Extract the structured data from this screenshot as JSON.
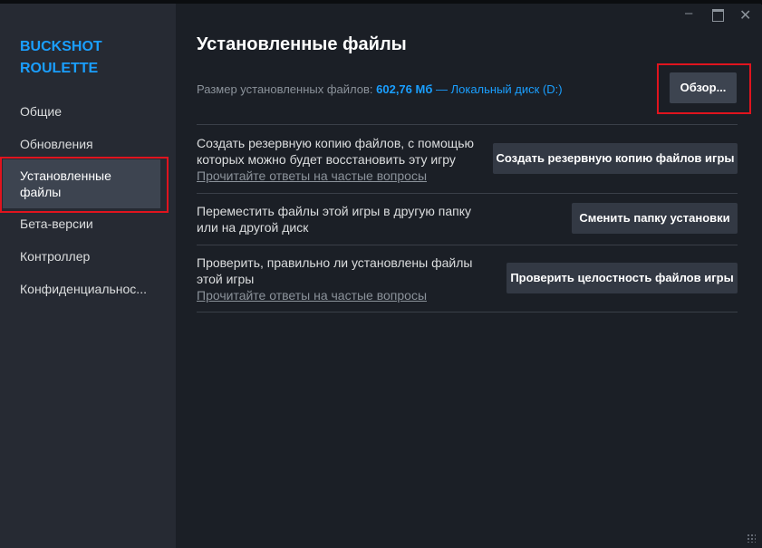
{
  "sidebar": {
    "app_title": "BUCKSHOT ROULETTE",
    "items": [
      {
        "label": "Общие"
      },
      {
        "label": "Обновления"
      },
      {
        "label": "Установленные файлы",
        "active": true
      },
      {
        "label": "Бета-версии"
      },
      {
        "label": "Контроллер"
      },
      {
        "label": "Конфиденциальнос..."
      }
    ]
  },
  "window_controls": {
    "minimize": "–",
    "maximize": "□",
    "close": "✕"
  },
  "main": {
    "title": "Установленные файлы",
    "size_label": "Размер установленных файлов: ",
    "size_value": "602,76 Мб",
    "disk": " — Локальный диск (D:)",
    "browse_button": "Обзор...",
    "options": [
      {
        "text": "Создать резервную копию файлов, с помощью которых можно будет восстановить эту игру",
        "faq": "Прочитайте ответы на частые вопросы",
        "button": "Создать резервную копию файлов игры"
      },
      {
        "text": "Переместить файлы этой игры в другую папку или на другой диск",
        "faq": "",
        "button": "Сменить папку установки"
      },
      {
        "text": "Проверить, правильно ли установлены файлы этой игры",
        "faq": "Прочитайте ответы на частые вопросы",
        "button": "Проверить целостность файлов игры"
      }
    ]
  },
  "colors": {
    "accent": "#1a9fff",
    "highlight": "#e0141e",
    "sidebar_bg": "#262a33",
    "main_bg": "#1b1f26"
  }
}
